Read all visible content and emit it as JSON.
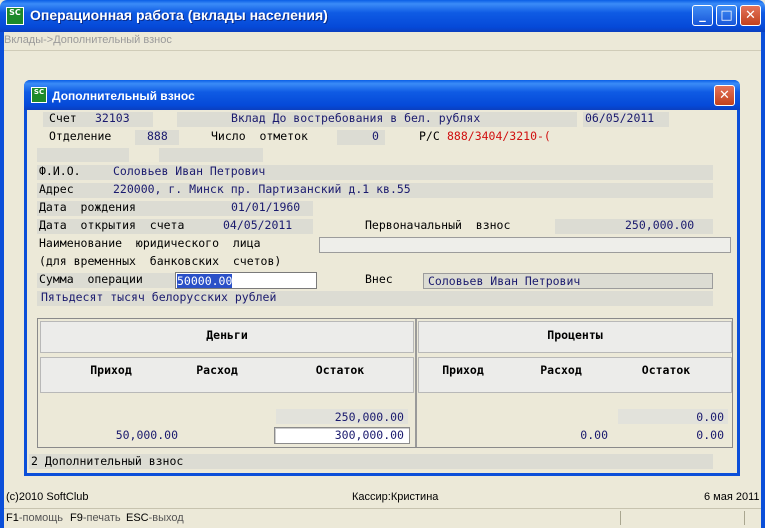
{
  "window": {
    "title": "Операционная работа (вклады населения)",
    "icon": "SC",
    "breadcrumb": "Вклады->Дополнительный взнос",
    "buttons": {
      "minimize": "_",
      "maximize": "□",
      "close": "✕"
    }
  },
  "dialog": {
    "title": "Дополнительный взнос",
    "icon": "SC",
    "close": "✕",
    "account": {
      "label": "Счет",
      "value": "32103",
      "deposit_type": "Вклад До востребования в бел. рублях",
      "date": "06/05/2011"
    },
    "branch": {
      "label": "Отделение",
      "value": "888",
      "marks_label": "Число  отметок",
      "marks_value": "0",
      "rs_label": "Р/С",
      "rs_value": "888/3404/3210-("
    },
    "client": {
      "fio_label": "Ф.И.О.",
      "fio_value": "Соловьев Иван Петрович",
      "address_label": "Адрес",
      "address_value": "220000, г. Минск пр. Партизанский д.1 кв.55",
      "birth_label": "Дата  рождения",
      "birth_value": "01/01/1960",
      "open_label": "Дата  открытия  счета",
      "open_value": "04/05/2011",
      "initial_label": "Первоначальный  взнос",
      "initial_value": "250,000.00",
      "legal_label": "Наименование  юридического  лица",
      "legal_note": "(для временных  банковских  счетов)",
      "legal_value": ""
    },
    "operation": {
      "sum_label": "Сумма  операции",
      "sum_value": "50000.00",
      "payer_label": "Внес",
      "payer_value": "Соловьев Иван Петрович",
      "sum_words": "Пятьдесят тысяч белорусских рублей"
    },
    "table": {
      "money_header": "Деньги",
      "percent_header": "Проценты",
      "columns": [
        "Приход",
        "Расход",
        "Остаток",
        "Приход",
        "Расход",
        "Остаток"
      ],
      "row1": {
        "money_balance": "250,000.00",
        "pct_balance": "0.00"
      },
      "row2": {
        "money_income": "50,000.00",
        "money_balance": "300,000.00",
        "pct_expense": "0.00",
        "pct_balance": "0.00"
      }
    },
    "footer": "2 Дополнительный взнос"
  },
  "status": {
    "copyright": "(c)2010 SoftClub",
    "cashier": "Кассир:Кристина",
    "date": "6 мая 2011",
    "hint_f1": "F1",
    "hint_f1_text": "-помощь",
    "hint_f9": "F9",
    "hint_f9_text": "-печать",
    "hint_esc": "ESC",
    "hint_esc_text": "-выход"
  }
}
